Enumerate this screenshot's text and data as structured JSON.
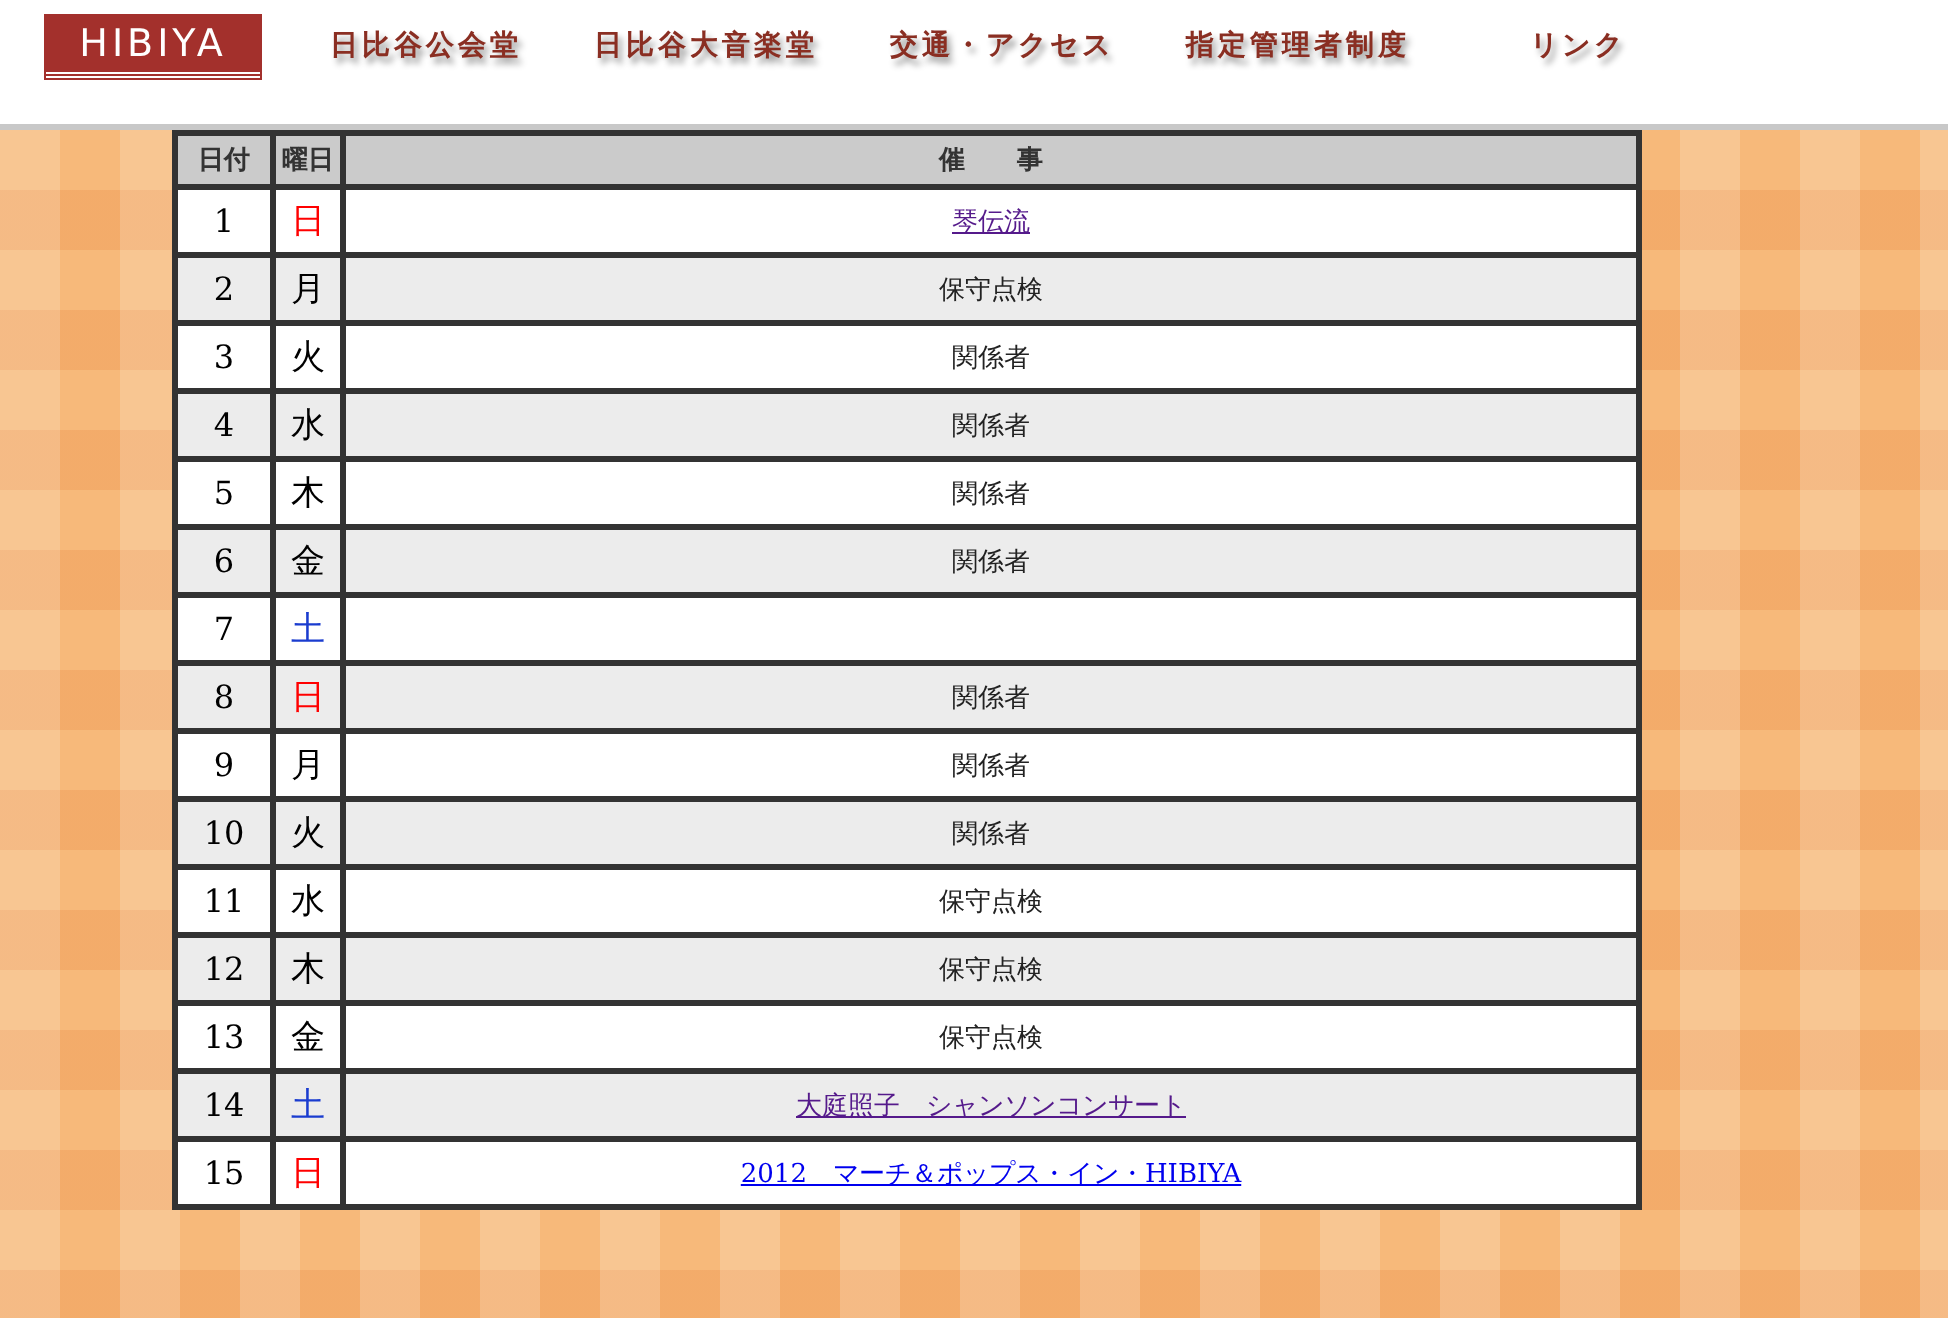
{
  "logo": {
    "text": "HIBIYA"
  },
  "nav": [
    "日比谷公会堂",
    "日比谷大音楽堂",
    "交通・アクセス",
    "指定管理者制度",
    "リンク"
  ],
  "table": {
    "columns": [
      "日付",
      "曜日",
      "催　　事"
    ],
    "rows": [
      {
        "date": "1",
        "day": "日",
        "color": "#ff0000",
        "event": {
          "kind": "link",
          "text": "琴伝流",
          "visited": true
        }
      },
      {
        "date": "2",
        "day": "月",
        "color": "#000000",
        "event": {
          "kind": "text",
          "text": "保守点検"
        }
      },
      {
        "date": "3",
        "day": "火",
        "color": "#000000",
        "event": {
          "kind": "text",
          "text": "関係者"
        }
      },
      {
        "date": "4",
        "day": "水",
        "color": "#000000",
        "event": {
          "kind": "text",
          "text": "関係者"
        }
      },
      {
        "date": "5",
        "day": "木",
        "color": "#000000",
        "event": {
          "kind": "text",
          "text": "関係者"
        }
      },
      {
        "date": "6",
        "day": "金",
        "color": "#000000",
        "event": {
          "kind": "text",
          "text": "関係者"
        }
      },
      {
        "date": "7",
        "day": "土",
        "color": "#1a3ccf"
      },
      {
        "date": "8",
        "day": "日",
        "color": "#ff0000",
        "event": {
          "kind": "text",
          "text": "関係者"
        }
      },
      {
        "date": "9",
        "day": "月",
        "color": "#000000",
        "event": {
          "kind": "text",
          "text": "関係者"
        }
      },
      {
        "date": "10",
        "day": "火",
        "color": "#000000",
        "event": {
          "kind": "text",
          "text": "関係者"
        }
      },
      {
        "date": "11",
        "day": "水",
        "color": "#000000",
        "event": {
          "kind": "text",
          "text": "保守点検"
        }
      },
      {
        "date": "12",
        "day": "木",
        "color": "#000000",
        "event": {
          "kind": "text",
          "text": "保守点検"
        }
      },
      {
        "date": "13",
        "day": "金",
        "color": "#000000",
        "event": {
          "kind": "text",
          "text": "保守点検"
        }
      },
      {
        "date": "14",
        "day": "土",
        "color": "#1a3ccf",
        "event": {
          "kind": "link",
          "text": "大庭照子　シャンソンコンサート",
          "visited": true
        }
      },
      {
        "date": "15",
        "day": "日",
        "color": "#ff0000",
        "event": {
          "kind": "link",
          "text": "2012　マーチ＆ポップス・イン・HIBIYA",
          "visited": false
        }
      }
    ]
  }
}
